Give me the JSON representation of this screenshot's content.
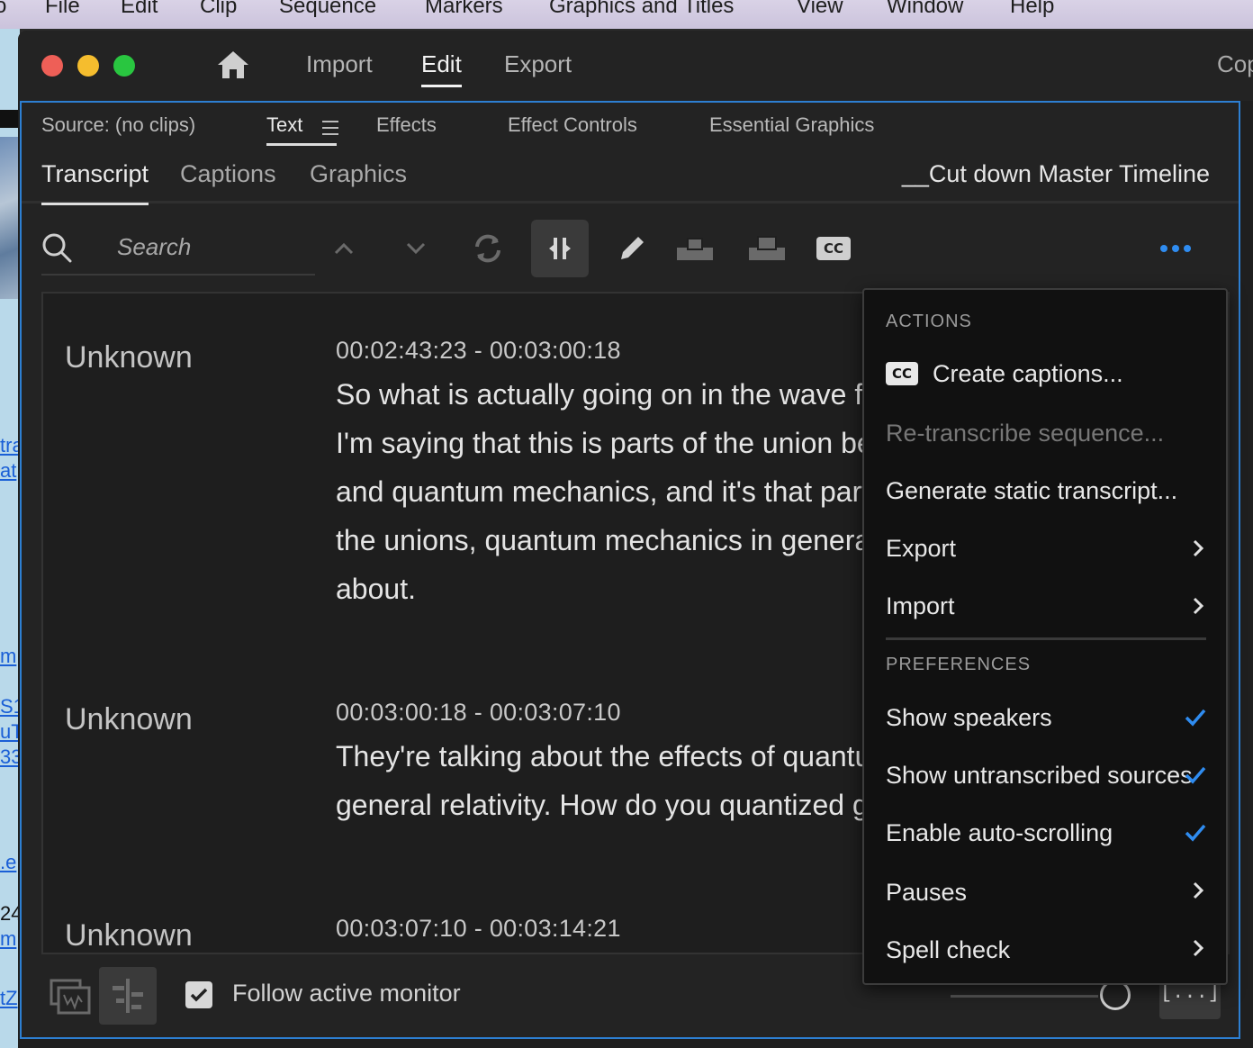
{
  "menubar": {
    "items": [
      "o",
      "File",
      "Edit",
      "Clip",
      "Sequence",
      "Markers",
      "Graphics and Titles",
      "View",
      "Window",
      "Help"
    ]
  },
  "background_window": {
    "fragments": [
      "tra",
      "at",
      "m",
      "S1",
      "uT",
      "33",
      ".e",
      "24",
      "m",
      "tZ"
    ]
  },
  "app": {
    "nav": {
      "import": "Import",
      "edit": "Edit",
      "export": "Export",
      "cut_label": "Cop"
    }
  },
  "panel_tabs": {
    "source": "Source: (no clips)",
    "text": "Text",
    "effects": "Effects",
    "effect_controls": "Effect Controls",
    "essential_graphics": "Essential Graphics"
  },
  "text_tabs": {
    "transcript": "Transcript",
    "captions": "Captions",
    "graphics": "Graphics",
    "sequence_name": "__Cut down Master Timeline"
  },
  "toolbar": {
    "search_placeholder": "Search",
    "cc_label": "CC"
  },
  "transcript": [
    {
      "speaker": "Unknown",
      "timecode": "00:02:43:23 - 00:03:00:18",
      "lines": [
        "So what is actually going on in the wave fu",
        "I'm saying that this is parts of the union be",
        "and quantum mechanics, and it's that part",
        "the unions, quantum mechanics in genera",
        "about."
      ]
    },
    {
      "speaker": "Unknown",
      "timecode": "00:03:00:18 - 00:03:07:10",
      "lines": [
        "They're talking about the effects of quantu",
        "general relativity. How do you quantized g"
      ]
    },
    {
      "speaker": "Unknown",
      "timecode": "00:03:07:10 - 00:03:14:21",
      "lines": []
    }
  ],
  "bottom": {
    "follow_label": "Follow active monitor",
    "follow_checked": true,
    "ellipsis_label": "[...]"
  },
  "menu": {
    "actions_header": "ACTIONS",
    "cc_badge": "CC",
    "create_captions": "Create captions...",
    "retranscribe": "Re-transcribe sequence...",
    "generate_static": "Generate static transcript...",
    "export": "Export",
    "import": "Import",
    "preferences_header": "PREFERENCES",
    "show_speakers": "Show speakers",
    "show_untranscribed": "Show untranscribed sources",
    "auto_scroll": "Enable auto-scrolling",
    "pauses": "Pauses",
    "spell_check": "Spell check"
  },
  "colors": {
    "accent_blue": "#2d7fd2",
    "check_blue": "#2f8cf0",
    "panel_bg": "#232323",
    "menu_bg": "#111111"
  }
}
